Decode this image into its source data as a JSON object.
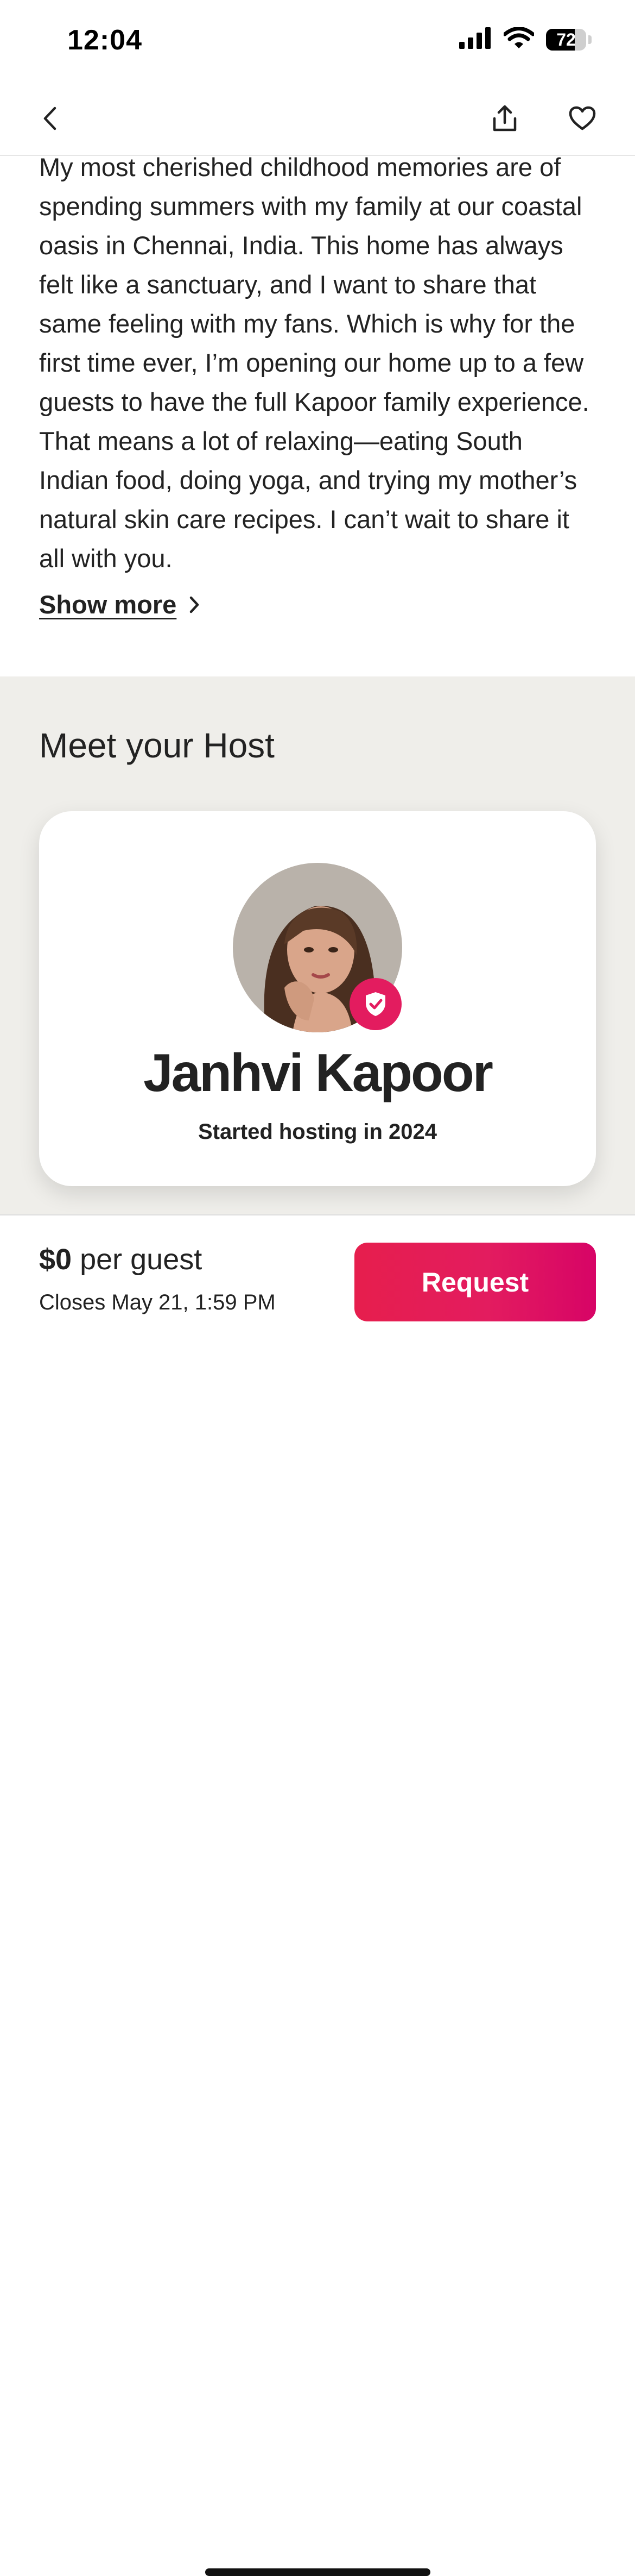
{
  "status_bar": {
    "time": "12:04",
    "battery_percent": "72",
    "battery_level": 0.72,
    "icons": [
      "signal-icon",
      "wifi-icon",
      "battery-icon"
    ]
  },
  "nav": {
    "icons": [
      "chevron-left-icon",
      "share-icon",
      "heart-icon"
    ]
  },
  "description": {
    "text": "My most cherished childhood memories are of spending summers with my family at our coastal oasis in Chennai, India. This home has always felt like a sanctuary, and I want to share that same feeling with my fans. Which is why for the first time ever, I’m opening our home up to a few guests to have the full Kapoor family experience. That means a lot of relaxing—eating South Indian food, doing yoga, and trying my mother’s natural skin care recipes. I can’t wait to share it all with you.",
    "show_more_label": "Show more"
  },
  "host": {
    "heading": "Meet your Host",
    "name": "Janhvi Kapoor",
    "since": "Started hosting in 2024",
    "badge_icon": "verified-shield-icon"
  },
  "booking": {
    "price_amount": "$0",
    "price_unit": " per guest",
    "closes": "Closes May 21, 1:59 PM",
    "request_label": "Request"
  },
  "colors": {
    "accent": "#E31C5F",
    "text": "#222222",
    "section_bg": "#EFEEEA"
  }
}
